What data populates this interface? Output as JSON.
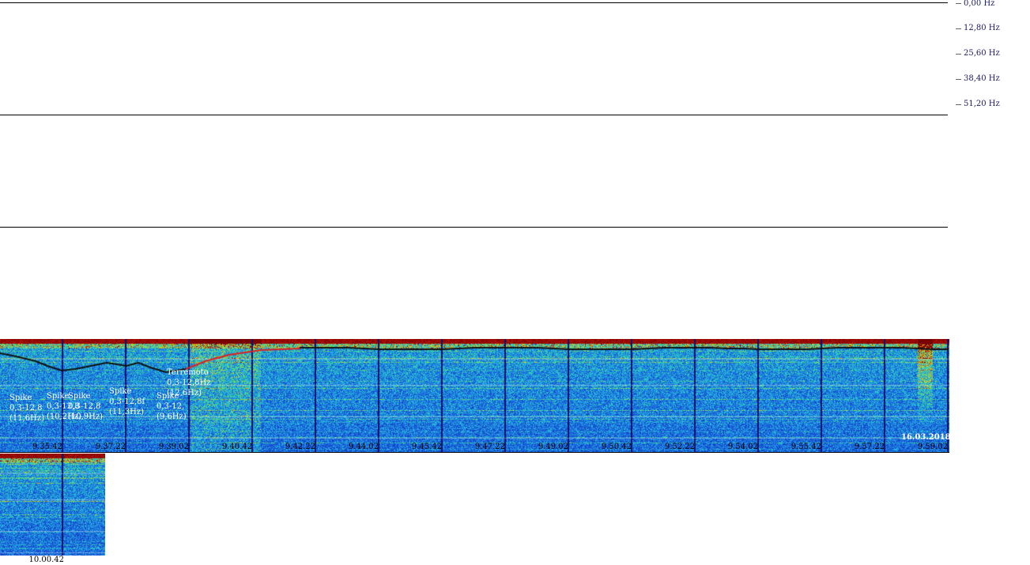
{
  "chart_data": {
    "type": "heatmap",
    "title": "",
    "frequency_axis": [
      "0,00 Hz",
      "12,80 Hz",
      "25,60 Hz",
      "38,40 Hz",
      "51,20 Hz"
    ],
    "time_labels_row1": [
      "9.35.42",
      "9.37.22",
      "9.39.02",
      "9.40.42",
      "9.42.22",
      "9.44.02",
      "9.45.42",
      "9.47.22",
      "9.49.02",
      "9.50.42",
      "9.52.22",
      "9.54.02",
      "9.55.42",
      "9.57.22",
      "9.59.02"
    ],
    "time_labels_row2": [
      "10.00.42"
    ],
    "date": "16.03.2018",
    "annotations": [
      {
        "title": "Spike",
        "range": "0,3-12,8",
        "freq": "(11,6Hz)"
      },
      {
        "title": "Spike",
        "range": "0,3-12,8",
        "freq": "(10,2Hz)"
      },
      {
        "title": "Spike",
        "range": "0,3-12,8",
        "freq": "(10,9Hz)"
      },
      {
        "title": "Spike",
        "range": "0,3-12,8f",
        "freq": "(11,3Hz)"
      },
      {
        "title": "Spike",
        "range": "0,3-12,",
        "freq": "(9,6Hz)"
      },
      {
        "title": "Terremoto",
        "range": "0,3-12,8Hz",
        "freq": "(12,6Hz)"
      }
    ],
    "colors": {
      "low": "#1a6fd6",
      "mid": "#2bd9a0",
      "high": "#f2e62a",
      "peak": "#7a0000",
      "trace_dark": "#111111",
      "trace_red": "#e02020",
      "grid_line": "#101070"
    }
  }
}
